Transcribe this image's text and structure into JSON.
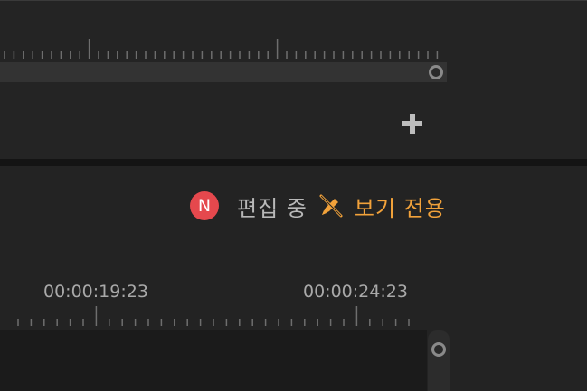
{
  "top_timeline": {
    "track_label": "top-track",
    "handle_label": "top-handle"
  },
  "add_button": {
    "icon": "plus-icon",
    "label": "+"
  },
  "status": {
    "avatar_letter": "N",
    "avatar_color": "#e5484d",
    "editing_text": "편집 중",
    "view_only_text": "보기 전용",
    "view_only_icon": "pencil-slash-icon",
    "accent_color": "#f2a23a"
  },
  "bottom_timeline": {
    "timecodes": [
      "00:00:19:23",
      "00:00:24:23"
    ]
  }
}
